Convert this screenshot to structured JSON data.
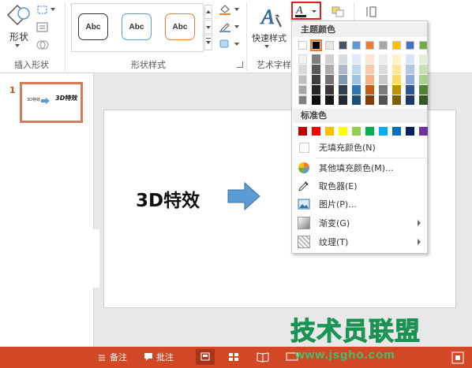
{
  "ribbon": {
    "insert_shape_group_label": "插入形状",
    "shape_button_label": "形状",
    "shape_styles_group_label": "形状样式",
    "style_samples": [
      "Abc",
      "Abc",
      "Abc"
    ],
    "quick_styles_label": "快速样式",
    "wordart_group_label": "艺术字样",
    "style_colors": [
      "#333333",
      "#5b9bd5",
      "#ed7d31"
    ]
  },
  "thumbnail": {
    "number": "1",
    "text_small": "3D特效",
    "text_3d": "3D特效"
  },
  "slide": {
    "title": "3D特效"
  },
  "status_bar": {
    "notes_label": "备注",
    "comments_label": "批注"
  },
  "menu": {
    "theme_colors_header": "主题颜色",
    "standard_colors_header": "标准色",
    "theme_colors": [
      "#ffffff",
      "#000000",
      "#e7e6e6",
      "#44546a",
      "#5b9bd5",
      "#ed7d31",
      "#a5a5a5",
      "#ffc000",
      "#4472c4",
      "#70ad47"
    ],
    "theme_shades": [
      [
        "#f2f2f2",
        "#d9d9d9",
        "#bfbfbf",
        "#a6a6a6",
        "#808080"
      ],
      [
        "#7f7f7f",
        "#595959",
        "#404040",
        "#262626",
        "#0d0d0d"
      ],
      [
        "#d0cece",
        "#aeaaaa",
        "#757171",
        "#3a3838",
        "#171616"
      ],
      [
        "#d6dce5",
        "#adb9ca",
        "#8497b0",
        "#333f50",
        "#222a35"
      ],
      [
        "#deebf7",
        "#bdd7ee",
        "#9dc3e6",
        "#2e75b6",
        "#1f4e79"
      ],
      [
        "#fbe5d6",
        "#f8cbad",
        "#f4b183",
        "#c55a11",
        "#843c0c"
      ],
      [
        "#ededed",
        "#dbdbdb",
        "#c9c9c9",
        "#7b7b7b",
        "#525252"
      ],
      [
        "#fff2cc",
        "#ffe699",
        "#ffd966",
        "#bf9000",
        "#7f6000"
      ],
      [
        "#dae3f3",
        "#b4c7e7",
        "#8faadc",
        "#2f5597",
        "#203864"
      ],
      [
        "#e2f0d9",
        "#c5e0b4",
        "#a9d18e",
        "#548235",
        "#385723"
      ]
    ],
    "standard_colors": [
      "#c00000",
      "#ff0000",
      "#ffc000",
      "#ffff00",
      "#92d050",
      "#00b050",
      "#00b0f0",
      "#0070c0",
      "#002060",
      "#7030a0"
    ],
    "items": {
      "no_fill": "无填充颜色(N)",
      "more_colors": "其他填充颜色(M)...",
      "eyedropper": "取色器(E)",
      "picture": "图片(P)...",
      "gradient": "渐变(G)",
      "texture": "纹理(T)"
    }
  },
  "watermark": {
    "main": "技术员联盟",
    "sub": "www.jsgho.com"
  }
}
